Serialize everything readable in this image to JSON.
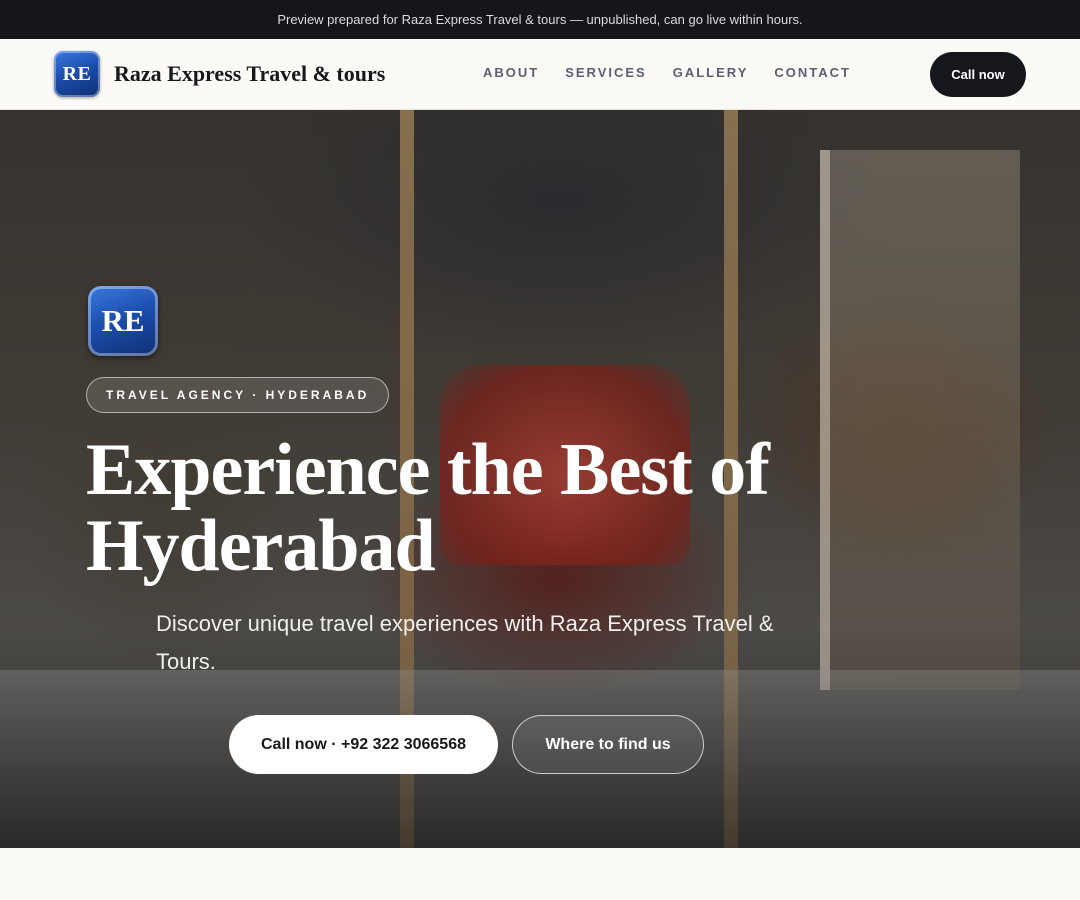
{
  "preview_banner": {
    "text": "Preview prepared for Raza Express Travel & tours — unpublished, can go live within hours."
  },
  "header": {
    "logo_text": "RE",
    "brand_name": "Raza Express Travel & tours",
    "nav": [
      {
        "label": "ABOUT"
      },
      {
        "label": "SERVICES"
      },
      {
        "label": "GALLERY"
      },
      {
        "label": "CONTACT"
      }
    ],
    "cta_label": "Call now"
  },
  "hero": {
    "logo_text": "RE",
    "eyebrow": "TRAVEL AGENCY · HYDERABAD",
    "headline": "Experience the Best of Hyderabad",
    "subtitle": "Discover unique travel experiences with Raza Express Travel & Tours.",
    "primary_cta": "Call now · +92 322 3066568",
    "secondary_cta": "Where to find us"
  },
  "colors": {
    "banner_bg": "#14161b",
    "nav_bg": "#fbfaf7",
    "accent_dark": "#15171c",
    "logo_blue": "#1c4fae"
  }
}
